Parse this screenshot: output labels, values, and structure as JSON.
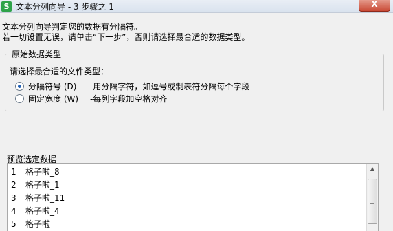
{
  "window": {
    "title": "文本分列向导 - 3 步骤之 1",
    "app_icon": "S",
    "close_glyph": "X"
  },
  "instructions": {
    "line1": "文本分列向导判定您的数据有分隔符。",
    "line2": "若一切设置无误，请单击“下一步”，否则请选择最合适的数据类型。"
  },
  "original_type_group": {
    "legend": "原始数据类型",
    "prompt": "请选择最合适的文件类型：",
    "options": [
      {
        "label": "分隔符号 (D)",
        "description": "-用分隔字符，如逗号或制表符分隔每个字段",
        "selected": true
      },
      {
        "label": "固定宽度 (W)",
        "description": "-每列字段加空格对齐",
        "selected": false
      }
    ]
  },
  "preview": {
    "label": "预览选定数据",
    "rows": [
      {
        "num": "1",
        "text": "格子啦_8"
      },
      {
        "num": "2",
        "text": "格子啦_1"
      },
      {
        "num": "3",
        "text": "格子啦_11"
      },
      {
        "num": "4",
        "text": "格子啦_4"
      },
      {
        "num": "5",
        "text": "格子啦"
      }
    ],
    "scroll_up_glyph": "▲"
  },
  "colors": {
    "accent": "#1f5fb5",
    "app_icon": "#2fa34a",
    "close_button": "#c94a35"
  }
}
